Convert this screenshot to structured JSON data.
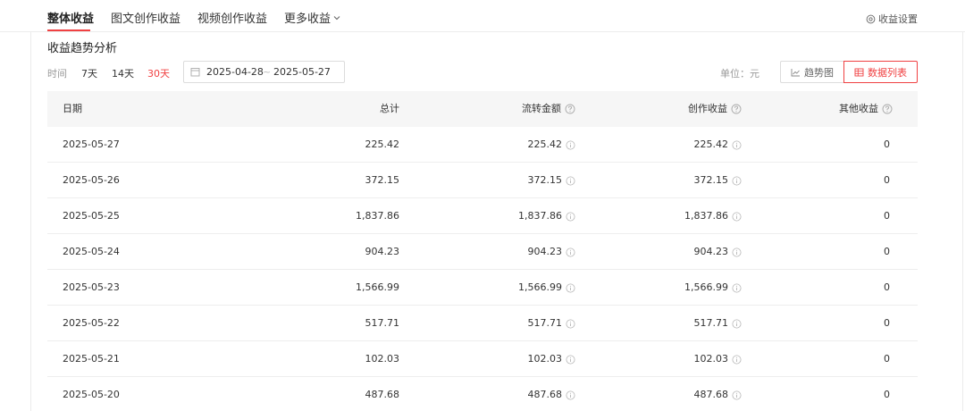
{
  "tabs": [
    {
      "label": "整体收益",
      "active": true
    },
    {
      "label": "图文创作收益",
      "active": false
    },
    {
      "label": "视频创作收益",
      "active": false
    },
    {
      "label": "更多收益",
      "active": false
    }
  ],
  "settings_label": "收益设置",
  "section_title": "收益趋势分析",
  "filter": {
    "label": "时间",
    "ranges": [
      "7天",
      "14天",
      "30天"
    ],
    "active_range": "30天",
    "date_start": "2025-04-28",
    "date_separator": "~",
    "date_end": "2025-05-27"
  },
  "unit_label": "单位：元",
  "view_toggle": {
    "trend_label": "趋势图",
    "list_label": "数据列表",
    "active": "list"
  },
  "table": {
    "headers": {
      "date": "日期",
      "total": "总计",
      "flow": "流转金额",
      "creation": "创作收益",
      "other": "其他收益"
    },
    "rows": [
      {
        "date": "2025-05-27",
        "total": "225.42",
        "flow": "225.42",
        "creation": "225.42",
        "other": "0"
      },
      {
        "date": "2025-05-26",
        "total": "372.15",
        "flow": "372.15",
        "creation": "372.15",
        "other": "0"
      },
      {
        "date": "2025-05-25",
        "total": "1,837.86",
        "flow": "1,837.86",
        "creation": "1,837.86",
        "other": "0"
      },
      {
        "date": "2025-05-24",
        "total": "904.23",
        "flow": "904.23",
        "creation": "904.23",
        "other": "0"
      },
      {
        "date": "2025-05-23",
        "total": "1,566.99",
        "flow": "1,566.99",
        "creation": "1,566.99",
        "other": "0"
      },
      {
        "date": "2025-05-22",
        "total": "517.71",
        "flow": "517.71",
        "creation": "517.71",
        "other": "0"
      },
      {
        "date": "2025-05-21",
        "total": "102.03",
        "flow": "102.03",
        "creation": "102.03",
        "other": "0"
      },
      {
        "date": "2025-05-20",
        "total": "487.68",
        "flow": "487.68",
        "creation": "487.68",
        "other": "0"
      }
    ]
  },
  "colors": {
    "accent": "#f04142",
    "header_bg": "#f6f6f6",
    "border": "#dcdcdc",
    "muted_text": "#999999"
  },
  "icons": {
    "settings": "settings-circle-icon",
    "calendar": "calendar-icon",
    "trend": "trend-chart-icon",
    "list": "table-list-icon",
    "help": "question-circle-icon",
    "info": "info-circle-icon",
    "dropdown": "chevron-down-icon"
  }
}
